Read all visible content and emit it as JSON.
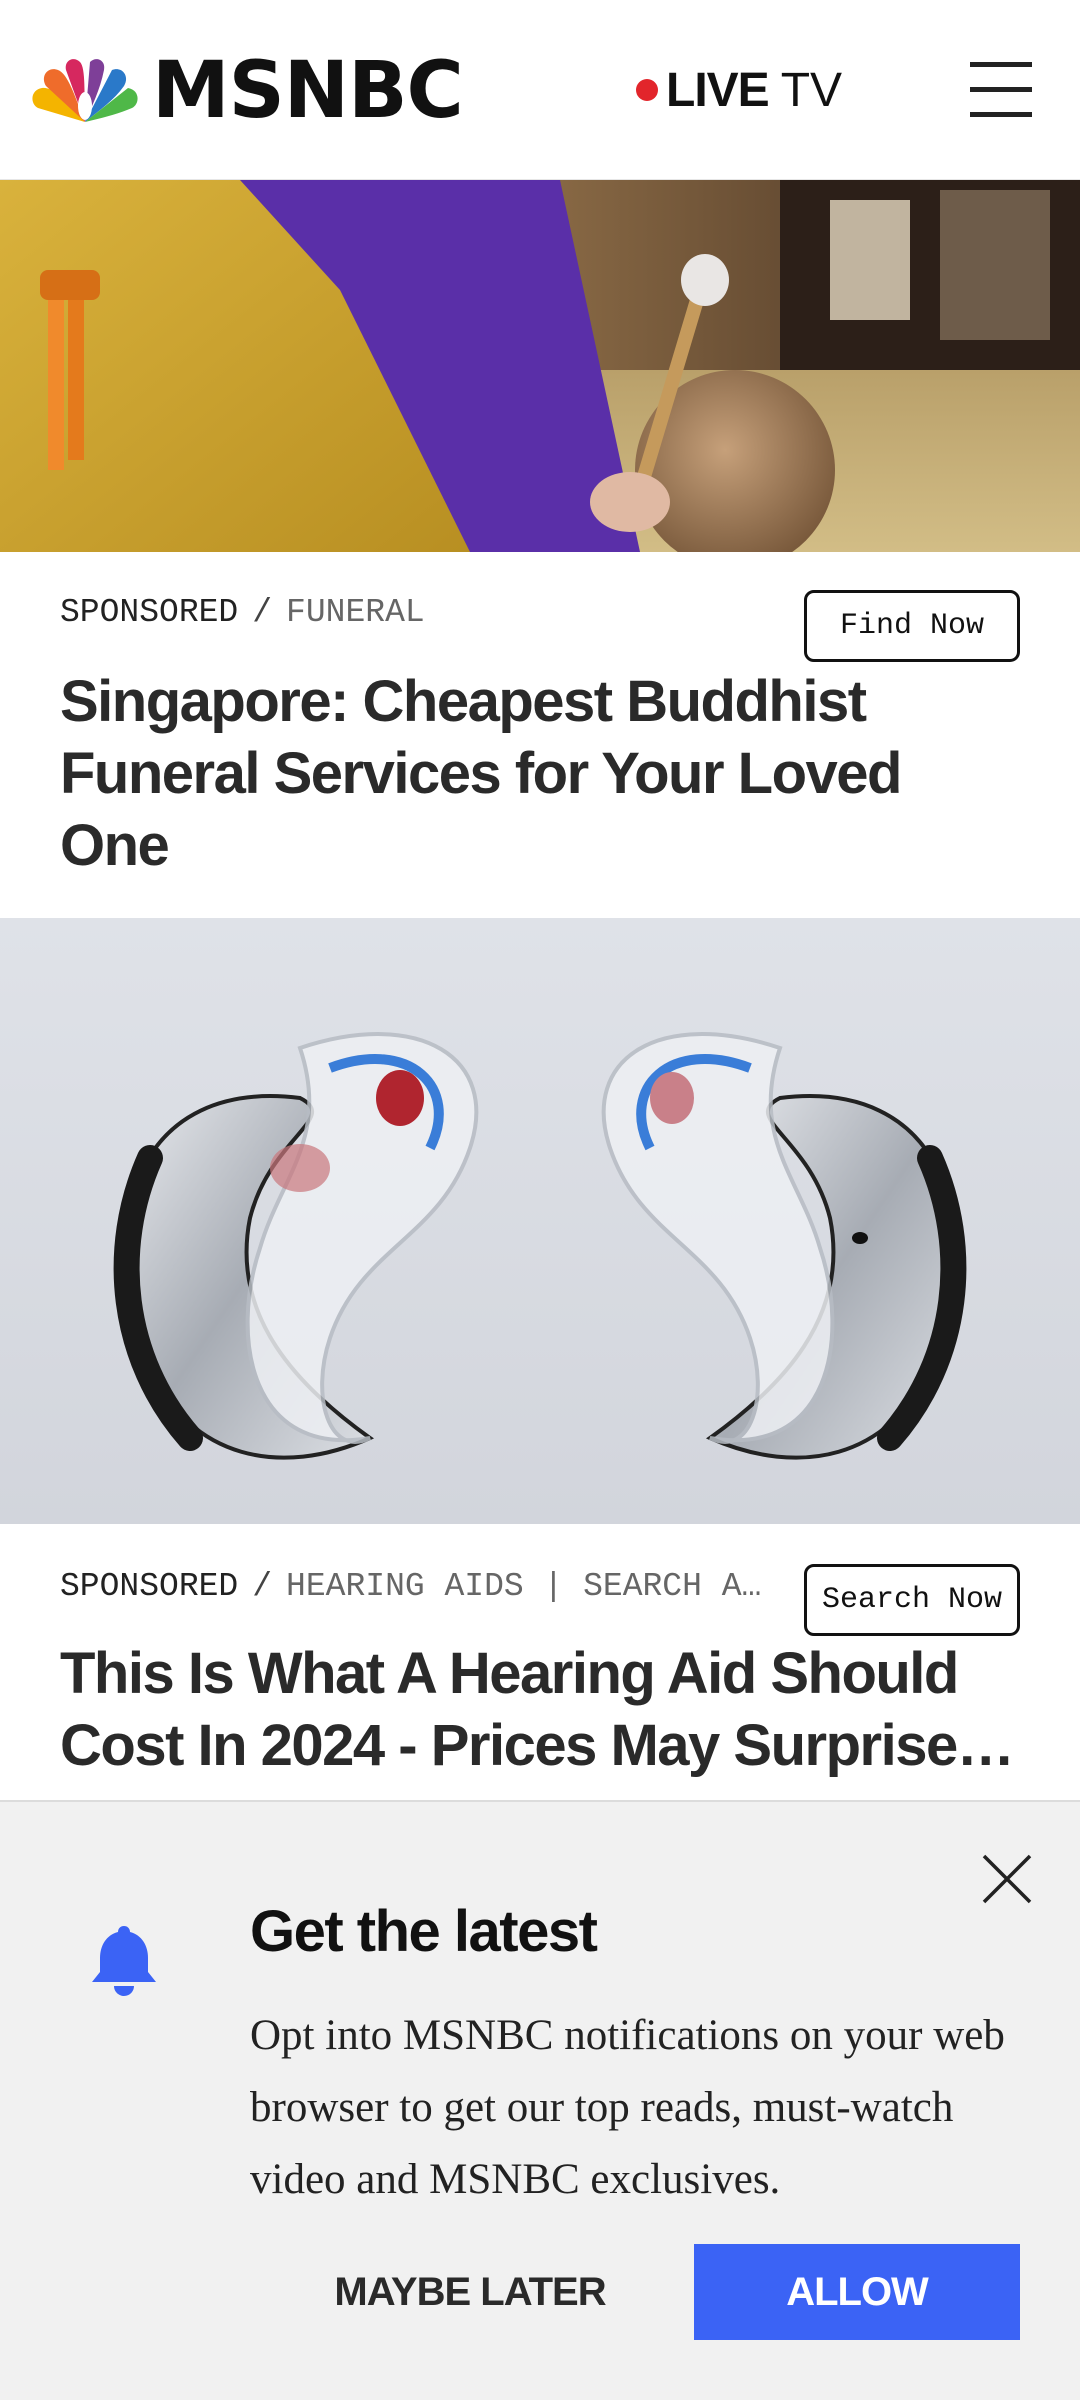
{
  "header": {
    "logo_text": "MSNBC",
    "live_label": "LIVE",
    "tv_label": "TV",
    "live_dot_color": "#e2252b"
  },
  "cards": [
    {
      "label": "SPONSORED",
      "separator": "/",
      "category": "FUNERAL",
      "cta": "Find Now",
      "headline": "Singapore: Cheapest Buddhist Funeral Services for Your Loved One"
    },
    {
      "label": "SPONSORED",
      "separator": "/",
      "category": "HEARING AIDS | SEARCH A…",
      "cta": "Search Now",
      "headline": "This Is What A Hearing Aid Should Cost In 2024 - Prices May Surprise…"
    }
  ],
  "notification": {
    "title": "Get the latest",
    "body": "Opt into MSNBC notifications on your web browser to get our top reads, must-watch video and MSNBC exclusives.",
    "maybe_label": "MAYBE LATER",
    "allow_label": "ALLOW",
    "accent_color": "#3b63f5"
  }
}
